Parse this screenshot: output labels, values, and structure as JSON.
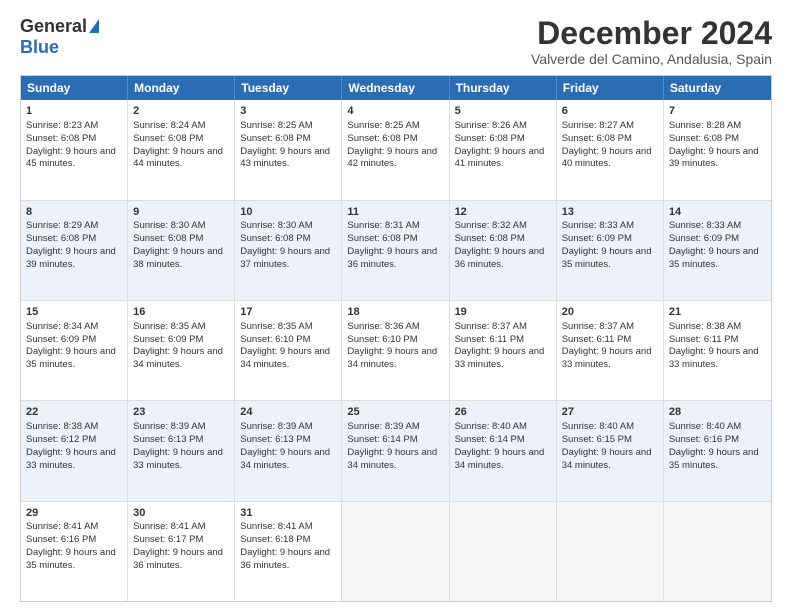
{
  "logo": {
    "general": "General",
    "blue": "Blue"
  },
  "title": "December 2024",
  "location": "Valverde del Camino, Andalusia, Spain",
  "days": [
    "Sunday",
    "Monday",
    "Tuesday",
    "Wednesday",
    "Thursday",
    "Friday",
    "Saturday"
  ],
  "weeks": [
    [
      {
        "day": "1",
        "sunrise": "8:23 AM",
        "sunset": "6:08 PM",
        "daylight": "9 hours and 45 minutes."
      },
      {
        "day": "2",
        "sunrise": "8:24 AM",
        "sunset": "6:08 PM",
        "daylight": "9 hours and 44 minutes."
      },
      {
        "day": "3",
        "sunrise": "8:25 AM",
        "sunset": "6:08 PM",
        "daylight": "9 hours and 43 minutes."
      },
      {
        "day": "4",
        "sunrise": "8:25 AM",
        "sunset": "6:08 PM",
        "daylight": "9 hours and 42 minutes."
      },
      {
        "day": "5",
        "sunrise": "8:26 AM",
        "sunset": "6:08 PM",
        "daylight": "9 hours and 41 minutes."
      },
      {
        "day": "6",
        "sunrise": "8:27 AM",
        "sunset": "6:08 PM",
        "daylight": "9 hours and 40 minutes."
      },
      {
        "day": "7",
        "sunrise": "8:28 AM",
        "sunset": "6:08 PM",
        "daylight": "9 hours and 39 minutes."
      }
    ],
    [
      {
        "day": "8",
        "sunrise": "8:29 AM",
        "sunset": "6:08 PM",
        "daylight": "9 hours and 39 minutes."
      },
      {
        "day": "9",
        "sunrise": "8:30 AM",
        "sunset": "6:08 PM",
        "daylight": "9 hours and 38 minutes."
      },
      {
        "day": "10",
        "sunrise": "8:30 AM",
        "sunset": "6:08 PM",
        "daylight": "9 hours and 37 minutes."
      },
      {
        "day": "11",
        "sunrise": "8:31 AM",
        "sunset": "6:08 PM",
        "daylight": "9 hours and 36 minutes."
      },
      {
        "day": "12",
        "sunrise": "8:32 AM",
        "sunset": "6:08 PM",
        "daylight": "9 hours and 36 minutes."
      },
      {
        "day": "13",
        "sunrise": "8:33 AM",
        "sunset": "6:09 PM",
        "daylight": "9 hours and 35 minutes."
      },
      {
        "day": "14",
        "sunrise": "8:33 AM",
        "sunset": "6:09 PM",
        "daylight": "9 hours and 35 minutes."
      }
    ],
    [
      {
        "day": "15",
        "sunrise": "8:34 AM",
        "sunset": "6:09 PM",
        "daylight": "9 hours and 35 minutes."
      },
      {
        "day": "16",
        "sunrise": "8:35 AM",
        "sunset": "6:09 PM",
        "daylight": "9 hours and 34 minutes."
      },
      {
        "day": "17",
        "sunrise": "8:35 AM",
        "sunset": "6:10 PM",
        "daylight": "9 hours and 34 minutes."
      },
      {
        "day": "18",
        "sunrise": "8:36 AM",
        "sunset": "6:10 PM",
        "daylight": "9 hours and 34 minutes."
      },
      {
        "day": "19",
        "sunrise": "8:37 AM",
        "sunset": "6:11 PM",
        "daylight": "9 hours and 33 minutes."
      },
      {
        "day": "20",
        "sunrise": "8:37 AM",
        "sunset": "6:11 PM",
        "daylight": "9 hours and 33 minutes."
      },
      {
        "day": "21",
        "sunrise": "8:38 AM",
        "sunset": "6:11 PM",
        "daylight": "9 hours and 33 minutes."
      }
    ],
    [
      {
        "day": "22",
        "sunrise": "8:38 AM",
        "sunset": "6:12 PM",
        "daylight": "9 hours and 33 minutes."
      },
      {
        "day": "23",
        "sunrise": "8:39 AM",
        "sunset": "6:13 PM",
        "daylight": "9 hours and 33 minutes."
      },
      {
        "day": "24",
        "sunrise": "8:39 AM",
        "sunset": "6:13 PM",
        "daylight": "9 hours and 34 minutes."
      },
      {
        "day": "25",
        "sunrise": "8:39 AM",
        "sunset": "6:14 PM",
        "daylight": "9 hours and 34 minutes."
      },
      {
        "day": "26",
        "sunrise": "8:40 AM",
        "sunset": "6:14 PM",
        "daylight": "9 hours and 34 minutes."
      },
      {
        "day": "27",
        "sunrise": "8:40 AM",
        "sunset": "6:15 PM",
        "daylight": "9 hours and 34 minutes."
      },
      {
        "day": "28",
        "sunrise": "8:40 AM",
        "sunset": "6:16 PM",
        "daylight": "9 hours and 35 minutes."
      }
    ],
    [
      {
        "day": "29",
        "sunrise": "8:41 AM",
        "sunset": "6:16 PM",
        "daylight": "9 hours and 35 minutes."
      },
      {
        "day": "30",
        "sunrise": "8:41 AM",
        "sunset": "6:17 PM",
        "daylight": "9 hours and 36 minutes."
      },
      {
        "day": "31",
        "sunrise": "8:41 AM",
        "sunset": "6:18 PM",
        "daylight": "9 hours and 36 minutes."
      },
      null,
      null,
      null,
      null
    ]
  ],
  "labels": {
    "sunrise": "Sunrise:",
    "sunset": "Sunset:",
    "daylight": "Daylight:"
  }
}
